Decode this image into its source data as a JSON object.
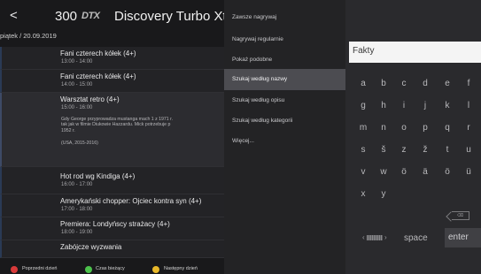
{
  "header": {
    "back_glyph": "<",
    "channel_number": "300",
    "channel_logo": "DTX",
    "channel_name": "Discovery Turbo Xtr"
  },
  "date": "piątek / 20.09.2019",
  "programs": [
    {
      "title": "Fani czterech kółek (4+)",
      "time": "13:00 - 14:00"
    },
    {
      "title": "Fani czterech kółek (4+)",
      "time": "14:00 - 15:00"
    },
    {
      "title": "Warsztat retro (4+)",
      "time": "15:00 - 16:00",
      "description": "Gdy George przyprowadza mustanga mach 1 z 1971 r.\ntak jak w filmie Diukowie Hazzardu. Mick potrzebuje p\n1952 r.",
      "meta": "(USA, 2015-2016)"
    },
    {
      "title": "Hot rod wg Kindiga (4+)",
      "time": "16:00 - 17:00"
    },
    {
      "title": "Amerykański chopper: Ojciec kontra syn (4+)",
      "time": "17:00 - 18:00"
    },
    {
      "title": "Premiera: Londyńscy strażacy (4+)",
      "time": "18:00 - 19:00"
    },
    {
      "title": "Zabójcze wyzwania",
      "time": ""
    }
  ],
  "legend": {
    "items": [
      {
        "label": "Poprzedni dzień",
        "color": "#d83a3a"
      },
      {
        "label": "Czas bieżący",
        "color": "#4cc24c"
      },
      {
        "label": "Następny dzień",
        "color": "#e8b82a"
      }
    ]
  },
  "menu": {
    "items": [
      {
        "label": "Zawsze nagrywaj",
        "active": false
      },
      {
        "label": "Nagrywaj regularnie",
        "active": false
      },
      {
        "label": "Pokaż podobne",
        "active": false
      },
      {
        "label": "Szukaj według nazwy",
        "active": true
      },
      {
        "label": "Szukaj według opisu",
        "active": false
      },
      {
        "label": "Szukaj według kategorii",
        "active": false
      },
      {
        "label": "Więcej...",
        "active": false
      }
    ]
  },
  "keyboard": {
    "input_value": "Fakty",
    "rows": [
      [
        "a",
        "b",
        "c",
        "d",
        "e",
        "f"
      ],
      [
        "g",
        "h",
        "i",
        "j",
        "k",
        "l"
      ],
      [
        "m",
        "n",
        "o",
        "p",
        "q",
        "r"
      ],
      [
        "s",
        "š",
        "z",
        "ž",
        "t",
        "u"
      ],
      [
        "v",
        "w",
        "ö",
        "ä",
        "ö",
        "ü"
      ],
      [
        "x",
        "y"
      ]
    ],
    "backspace_label": "⌫",
    "space_label": "space",
    "enter_label": "enter"
  },
  "colors": {
    "active_menu": "#4c4c51",
    "search_bg": "#f4f4f4"
  }
}
